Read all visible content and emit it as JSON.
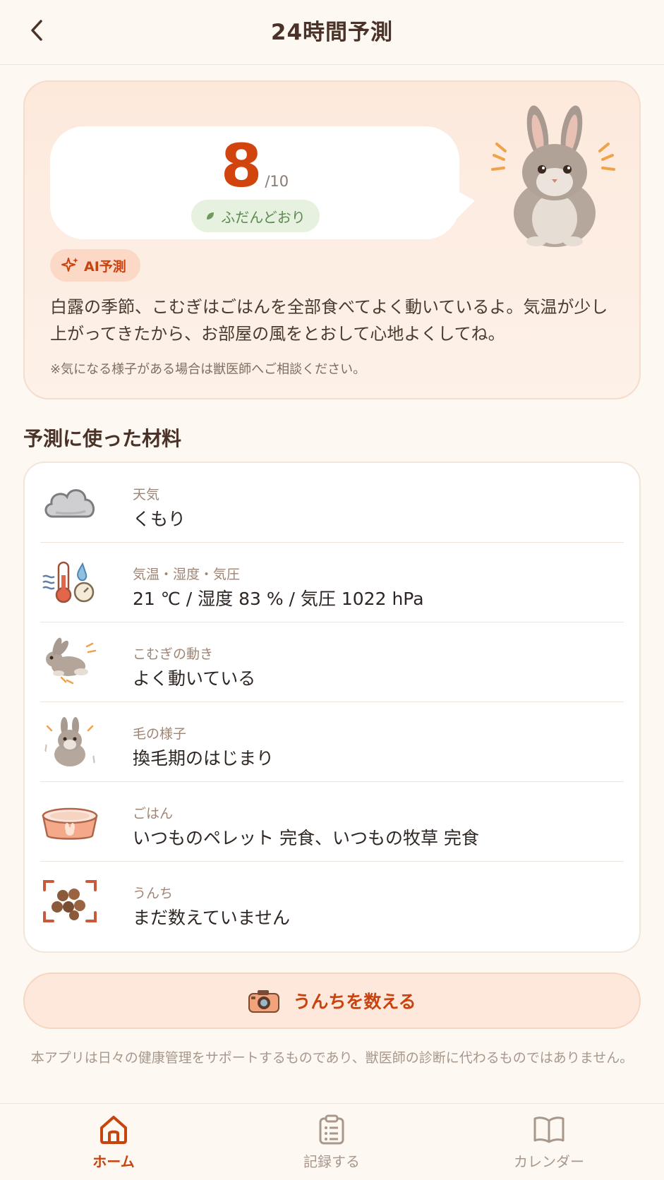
{
  "header": {
    "title": "24時間予測",
    "back_icon": "chevron-left-icon"
  },
  "forecast": {
    "score": "8",
    "score_max": "/10",
    "status": "ふだんどおり",
    "ai_badge": "AI予測",
    "message": "白露の季節、こむぎはごはんを全部食べてよく動いているよ。気温が少し上がってきたから、お部屋の風をとおして心地よくしてね。",
    "note": "※気になる様子がある場合は獣医師へご相談ください。"
  },
  "materials": {
    "title": "予測に使った材料",
    "items": [
      {
        "icon": "cloud-icon",
        "label": "天気",
        "value": "くもり"
      },
      {
        "icon": "thermometer-icon",
        "label": "気温・湿度・気圧",
        "value": "21 ℃ / 湿度 83 % / 気圧 1022 hPa"
      },
      {
        "icon": "running-rabbit-icon",
        "label": "こむぎの動き",
        "value": "よく動いている"
      },
      {
        "icon": "shedding-rabbit-icon",
        "label": "毛の様子",
        "value": "換毛期のはじまり"
      },
      {
        "icon": "food-bowl-icon",
        "label": "ごはん",
        "value": "いつものペレット 完食、いつもの牧草 完食"
      },
      {
        "icon": "droppings-scan-icon",
        "label": "うんち",
        "value": "まだ数えていません"
      }
    ]
  },
  "count_button": {
    "label": "うんちを数える",
    "icon": "camera-icon"
  },
  "disclaimer": "本アプリは日々の健康管理をサポートするものであり、獣医師の診断に代わるものではありません。",
  "nav": {
    "items": [
      {
        "label": "ホーム",
        "icon": "home-icon",
        "active": true
      },
      {
        "label": "記録する",
        "icon": "clipboard-icon",
        "active": false
      },
      {
        "label": "カレンダー",
        "icon": "book-icon",
        "active": false
      }
    ]
  },
  "colors": {
    "accent": "#c8430e",
    "score": "#d2440d",
    "status_green": "#5c8a4e",
    "background": "#fdf8f2"
  }
}
